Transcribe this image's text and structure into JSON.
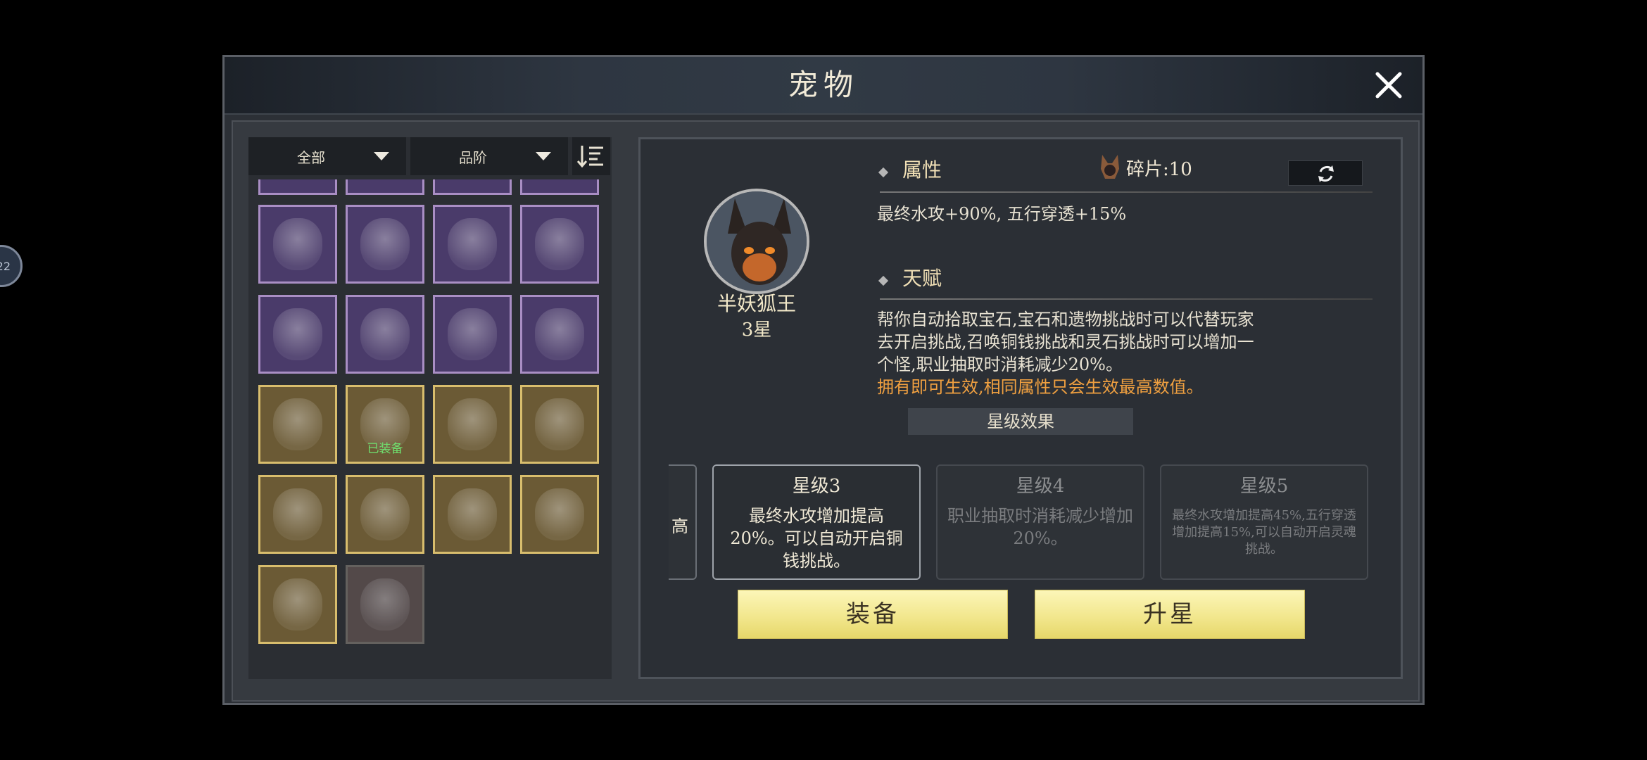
{
  "edge_badge": "22",
  "window": {
    "title": "宠物"
  },
  "filters": {
    "all": "全部",
    "quality": "品阶"
  },
  "pet_grid": [
    {
      "border": "purple",
      "equipped": false
    },
    {
      "border": "purple",
      "equipped": false
    },
    {
      "border": "purple",
      "equipped": false
    },
    {
      "border": "purple",
      "equipped": false
    },
    {
      "border": "purple",
      "equipped": false
    },
    {
      "border": "purple",
      "equipped": false
    },
    {
      "border": "purple",
      "equipped": false
    },
    {
      "border": "purple",
      "equipped": false
    },
    {
      "border": "gold",
      "equipped": false
    },
    {
      "border": "gold",
      "equipped": true,
      "tag": "已装备"
    },
    {
      "border": "gold",
      "equipped": false
    },
    {
      "border": "gold",
      "equipped": false
    },
    {
      "border": "gold",
      "equipped": false
    },
    {
      "border": "gold",
      "equipped": false
    },
    {
      "border": "gold",
      "equipped": false
    },
    {
      "border": "gold",
      "equipped": false
    },
    {
      "border": "gold",
      "equipped": false
    },
    {
      "border": "dim",
      "equipped": false
    }
  ],
  "detail": {
    "pet_name": "半妖狐王",
    "pet_star": "3星",
    "attr_title": "属性",
    "fragment_label": "碎片:10",
    "attr_text": "最终水攻+90%, 五行穿透+15%",
    "talent_title": "天赋",
    "talent_line1": "帮你自动拾取宝石,宝石和遗物挑战时可以代替玩家",
    "talent_line2": "去开启挑战,召唤铜钱挑战和灵石挑战时可以增加一",
    "talent_line3": "个怪,职业抽取时消耗减少20%。",
    "talent_note": "拥有即可生效,相同属性只会生效最高数值。",
    "star_effect_title": "星级效果",
    "partial_card_char": "高",
    "cards": [
      {
        "title": "星级3",
        "desc": "最终水攻增加提高20%。可以自动开启铜钱挑战。"
      },
      {
        "title": "星级4",
        "desc": "职业抽取时消耗减少增加20%。"
      },
      {
        "title": "星级5",
        "desc": "最终水攻增加提高45%,五行穿透增加提高15%,可以自动开启灵魂挑战。"
      }
    ],
    "equip_label": "装备",
    "upgrade_label": "升星"
  }
}
